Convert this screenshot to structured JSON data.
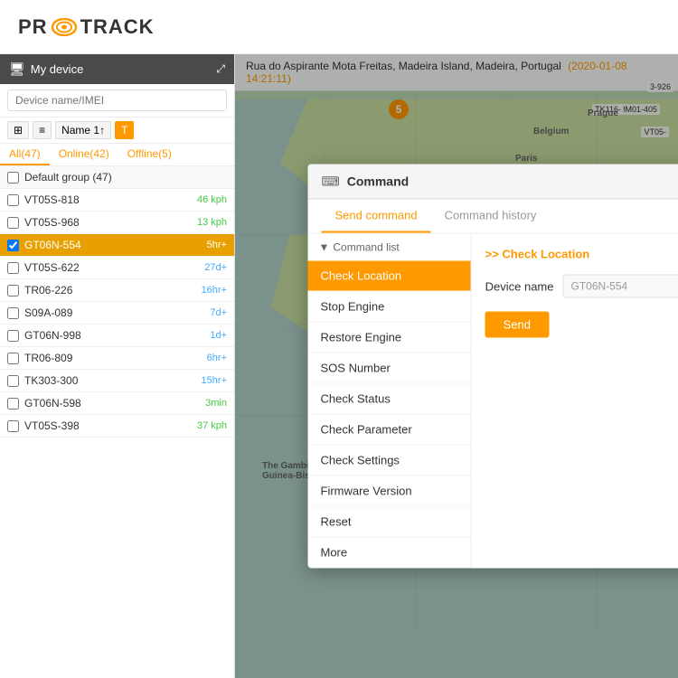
{
  "header": {
    "logo_text_pre": "PR",
    "logo_text_post": "TRACK"
  },
  "sidebar": {
    "title": "My device",
    "search_placeholder": "Device name/IMEI",
    "toolbar": {
      "icon_btn": "⊞",
      "list_btn": "≡",
      "name_btn": "Name 1↑",
      "t_btn": "T"
    },
    "tabs": [
      "All(47)",
      "Online(42)",
      "Offline(5)"
    ],
    "group": "Default group (47)",
    "devices": [
      {
        "name": "VT05S-818",
        "status": "46 kph",
        "status_type": "green"
      },
      {
        "name": "VT05S-968",
        "status": "13 kph",
        "status_type": "green"
      },
      {
        "name": "GT06N-554",
        "status": "5hr+",
        "status_type": "orange",
        "selected": true
      },
      {
        "name": "VT05S-622",
        "status": "27d+",
        "status_type": "blue"
      },
      {
        "name": "TR06-226",
        "status": "16hr+",
        "status_type": "blue"
      },
      {
        "name": "S09A-089",
        "status": "7d+",
        "status_type": "blue"
      },
      {
        "name": "GT06N-998",
        "status": "1d+",
        "status_type": "blue"
      },
      {
        "name": "TR06-809",
        "status": "6hr+",
        "status_type": "blue"
      },
      {
        "name": "TK303-300",
        "status": "15hr+",
        "status_type": "blue"
      },
      {
        "name": "GT06N-598",
        "status": "3min",
        "status_type": "green"
      },
      {
        "name": "VT05S-398",
        "status": "37 kph",
        "status_type": "green"
      }
    ]
  },
  "map": {
    "address": "Rua do Aspirante Mota Freitas, Madeira Island, Madeira, Portugal",
    "datetime": "(2020-01-08 14:21:11)",
    "marker_count": "5"
  },
  "modal": {
    "title": "Command",
    "close_icon": "×",
    "tabs": [
      "Send command",
      "Command history"
    ],
    "active_tab": "Send command",
    "command_section_label": "Command list",
    "selected_command": ">> Check Location",
    "commands": [
      "Check Location",
      "Stop Engine",
      "Restore Engine",
      "SOS Number",
      "Check Status",
      "Check Parameter",
      "Check Settings",
      "Firmware Version",
      "Reset",
      "More"
    ],
    "device_name_label": "Device name",
    "device_name_value": "GT06N-554",
    "send_button": "Send"
  }
}
